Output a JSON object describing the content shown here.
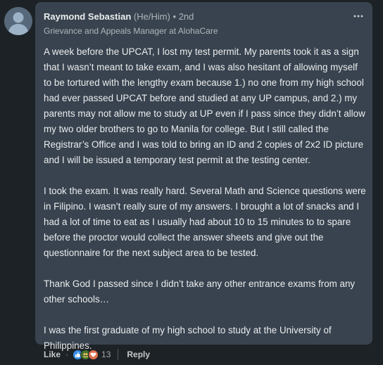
{
  "comment": {
    "author_name": "Raymond Sebastian",
    "pronouns": "(He/Him)",
    "separator": "•",
    "degree": "2nd",
    "headline": "Grievance and Appeals Manager at AlohaCare",
    "more_icon": "ellipsis-horizontal-icon",
    "paragraphs": [
      "A week before the UPCAT, I lost my test permit. My parents took it as a sign that I wasn’t meant to take exam, and I was also hesitant of allowing myself to be tortured with the lengthy exam because 1.) no one from my high school had ever passed UPCAT before and studied at any UP campus, and 2.) my parents may not allow me to study at UP even if I pass since they didn’t allow my two older brothers to go to Manila for college. But I still called the Registrar’s Office and I was told to bring an ID and 2 copies of 2x2 ID picture and I will be issued a temporary test permit at the testing center.",
      "I took the exam. It was really hard. Several Math and Science questions were in Filipino. I wasn’t really sure of my answers. I brought a lot of snacks and I had a lot of time to eat as I usually had about 10 to 15 minutes to to spare before the proctor would collect the answer sheets and give out the questionnaire for the next subject area to be tested.",
      "Thank God I passed since I didn’t take any other entrance exams from any other schools…",
      "I was the first graduate of my high school to study at the University of Philippines."
    ]
  },
  "actions": {
    "like_label": "Like",
    "dot": "·",
    "reaction_icons": [
      "like-reaction-icon",
      "celebrate-reaction-icon",
      "love-reaction-icon"
    ],
    "reaction_colors": [
      "#378fe9",
      "#44712e",
      "#df704d"
    ],
    "reaction_count": "13",
    "reply_label": "Reply"
  }
}
